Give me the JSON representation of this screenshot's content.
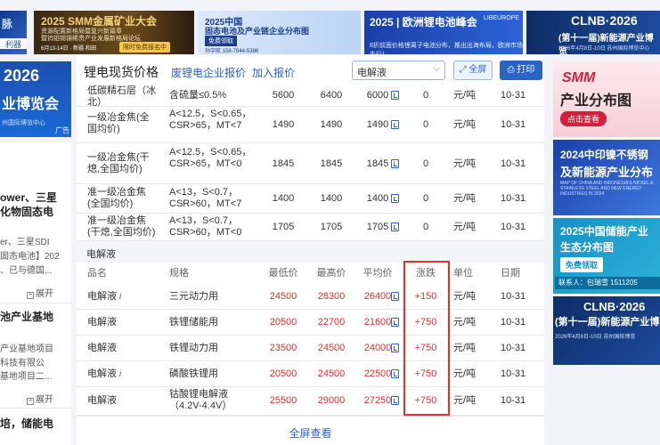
{
  "top_banners": {
    "b1": {
      "line1": "脉",
      "line2": "利器"
    },
    "b2": {
      "title": "2025 SMM金属矿业大会",
      "line1": "资源配置新格局暨复兴新篇章",
      "line2": "暨钨钼锡锑稀贵产业发展新格局论坛",
      "date": "6月13-14日 · 新疆·和田",
      "btn": "限时免费报名中"
    },
    "b3": {
      "line1": "2025中国",
      "line2": "固态电池及产业链企业分布图",
      "btn": "免费领取",
      "phone": "孙宇航 158-7944-5386"
    },
    "b4": {
      "title": "2025 | 欧洲锂电池峰会",
      "tag": "LIBEUROPE",
      "sub": "8折前面价格锂离子电池分布，推出出海布局，欧洲市场先行！"
    },
    "b5": {
      "title": "CLNB·2026",
      "sub": "(第十一届)新能源产业博览",
      "sub2": "2026年4月8日-10日 苏州国际博览中心"
    }
  },
  "left_ad": {
    "title": "2026",
    "sub": "业博览会",
    "venue": "州国际博览中心",
    "tag": "广告"
  },
  "left_news": [
    {
      "title": "ower、三星",
      "title2": "化物固态电",
      "lines": [
        "er、三星SDI",
        "固态电池】202",
        "、已与德国..."
      ],
      "expand": "展开"
    },
    {
      "title": "池产业基地",
      "lines": [
        "产业基地项目",
        "科技有限公",
        "基地项目二..."
      ],
      "expand": "展开"
    },
    {
      "title": "培，储能电",
      "lines": []
    }
  ],
  "main": {
    "title": "锂电现货价格",
    "link1": "废锂电企业报价",
    "link2": "加入报价",
    "select_value": "电解液",
    "fullscreen": "全屏",
    "print": "打印",
    "top_rows": [
      {
        "name": "低碳精石层（冰北）",
        "spec": "含硫量≤0.5%",
        "low": "5600",
        "high": "6400",
        "avg": "6000",
        "chg": "0",
        "unit": "元/吨",
        "date": "10-31"
      },
      {
        "name": "一级冶金焦(全国均价)",
        "spec": "A<12.5，S<0.65，CSR>65，MT<7",
        "low": "1490",
        "high": "1490",
        "avg": "1490",
        "chg": "0",
        "unit": "元/吨",
        "date": "10-31"
      },
      {
        "name": "一级冶金焦(干熄,全国均价)",
        "spec": "A<12.5，S<0.65，CSR>65，MT<0",
        "low": "1845",
        "high": "1845",
        "avg": "1845",
        "chg": "0",
        "unit": "元/吨",
        "date": "10-31"
      },
      {
        "name": "准一级冶金焦(全国均价)",
        "spec": "A<13，S<0.7，CSR>60，MT<7",
        "low": "1400",
        "high": "1400",
        "avg": "1400",
        "chg": "0",
        "unit": "元/吨",
        "date": "10-31"
      },
      {
        "name": "准一级冶金焦(干熄,全国均价)",
        "spec": "A<13，S<0.7，CSR>60，MT<0",
        "low": "1705",
        "high": "1705",
        "avg": "1705",
        "chg": "0",
        "unit": "元/吨",
        "date": "10-31"
      }
    ],
    "section": "电解液",
    "columns": {
      "name": "品名",
      "spec": "规格",
      "low": "最低价",
      "high": "最高价",
      "avg": "平均价",
      "chg": "涨跌",
      "unit": "单位",
      "date": "日期"
    },
    "rows": [
      {
        "name": "电解液",
        "info": "i",
        "spec": "三元动力用",
        "low": "24500",
        "high": "28300",
        "avg": "26400",
        "chg": "+150",
        "unit": "元/吨",
        "date": "10-31"
      },
      {
        "name": "电解液",
        "info": "",
        "spec": "铁锂储能用",
        "low": "20500",
        "high": "22700",
        "avg": "21600",
        "chg": "+750",
        "unit": "元/吨",
        "date": "10-31"
      },
      {
        "name": "电解液",
        "info": "",
        "spec": "铁锂动力用",
        "low": "23500",
        "high": "24500",
        "avg": "24000",
        "chg": "+750",
        "unit": "元/吨",
        "date": "10-31"
      },
      {
        "name": "电解液",
        "info": "i",
        "spec": "磷酸铁锂用",
        "low": "20500",
        "high": "24500",
        "avg": "22500",
        "chg": "+750",
        "unit": "元/吨",
        "date": "10-31"
      },
      {
        "name": "电解液",
        "info": "",
        "spec": "钴酸锂电解液（4.2V-4.4V）",
        "low": "25500",
        "high": "29000",
        "avg": "27250",
        "chg": "+750",
        "unit": "元/吨",
        "date": "10-31"
      }
    ],
    "footer": "全屏查看"
  },
  "right_ads": {
    "r1": {
      "brand": "SMM",
      "title": "产业分布图",
      "btn": "点击查看"
    },
    "r2": {
      "line1": "2024中印镍不锈钢",
      "line2": "及新能源产业分布",
      "small": "MAP OF CHINA AND INDONESIA'S NICKEL & STAINLESS STEEL AND NEW ENERGY INDUSTRIES IN 2024"
    },
    "r3": {
      "line1": "2025中国储能产业",
      "line2": "生态分布图",
      "btn": "免费领取",
      "contact": "联系人：包瑞雪 1511205"
    },
    "r4": {
      "title": "CLNB·2026",
      "sub": "(第十一届)新能源产业博",
      "date": "2026年4月8日-10日 苏州国际博览"
    }
  },
  "colors": {
    "accent": "#2c64c6",
    "up": "#e0312e",
    "highlight_box": "#e0312e"
  }
}
